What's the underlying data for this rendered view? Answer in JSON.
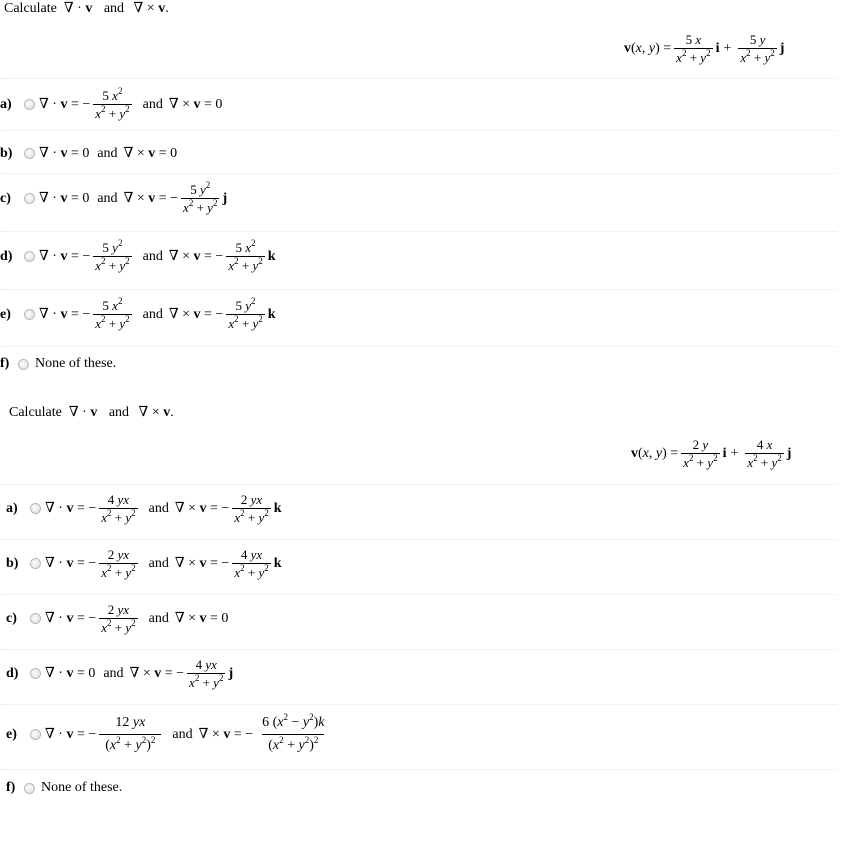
{
  "questions": [
    {
      "prompt": "Calculate ∇ · v and ∇ × v.",
      "given": {
        "lhs": "v(x, y) =",
        "i_term": {
          "num": "5 x",
          "den": "x² + y²",
          "unit": "i"
        },
        "plus": "+",
        "j_term": {
          "num": "5 y",
          "den": "x² + y²",
          "unit": "j"
        }
      },
      "options": [
        {
          "label": "a)",
          "div": "∇ · v = − 5x² / (x² + y²)",
          "curl": "∇ × v = 0"
        },
        {
          "label": "b)",
          "div": "∇ · v = 0",
          "curl": "∇ × v = 0"
        },
        {
          "label": "c)",
          "div": "∇ · v = 0",
          "curl": "∇ × v = − 5y² / (x² + y²) j"
        },
        {
          "label": "d)",
          "div": "∇ · v = − 5y² / (x² + y²)",
          "curl": "∇ × v = − 5x² / (x² + y²) k"
        },
        {
          "label": "e)",
          "div": "∇ · v = − 5x² / (x² + y²)",
          "curl": "∇ × v = − 5y² / (x² + y²) k"
        },
        {
          "label": "f)",
          "text": "None of these."
        }
      ]
    },
    {
      "prompt": "Calculate ∇ · v and ∇ × v.",
      "given": {
        "lhs": "v(x, y) =",
        "i_term": {
          "num": "2 y",
          "den": "x² + y²",
          "unit": "i"
        },
        "plus": "+",
        "j_term": {
          "num": "4 x",
          "den": "x² + y²",
          "unit": "j"
        }
      },
      "options": [
        {
          "label": "a)",
          "div": "∇ · v = − 4yx / (x² + y²)",
          "curl": "∇ × v = − 2yx / (x² + y²) k"
        },
        {
          "label": "b)",
          "div": "∇ · v = − 2yx / (x² + y²)",
          "curl": "∇ × v = − 4yx / (x² + y²) k"
        },
        {
          "label": "c)",
          "div": "∇ · v = − 2yx / (x² + y²)",
          "curl": "∇ × v = 0"
        },
        {
          "label": "d)",
          "div": "∇ · v = 0",
          "curl": "∇ × v = − 4yx / (x² + y²) j"
        },
        {
          "label": "e)",
          "div": "∇ · v = − 12yx / (x² + y²)²",
          "curl": "∇ × v = − 6(x² − y²)k / (x² + y²)²"
        },
        {
          "label": "f)",
          "text": "None of these."
        }
      ]
    }
  ],
  "words": {
    "and": "and",
    "calculate": "Calculate",
    "none": "None of these."
  },
  "colors": {
    "separator": "#e2e2e2",
    "radio_border": "#b9b9b9"
  }
}
